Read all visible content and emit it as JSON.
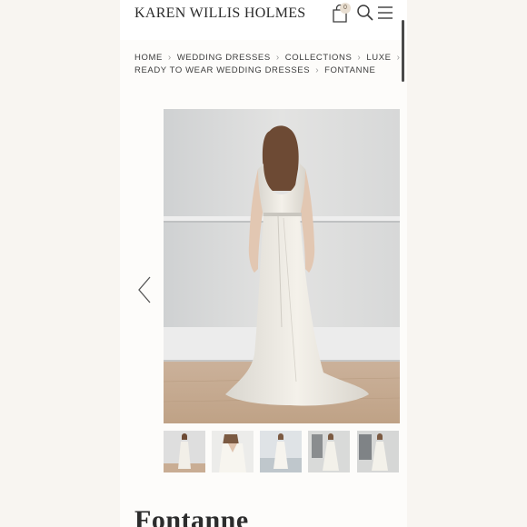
{
  "header": {
    "brand": "KAREN WILLIS HOLMES",
    "cart_count": "0"
  },
  "breadcrumb": {
    "items": [
      "HOME",
      "WEDDING DRESSES",
      "COLLECTIONS",
      "LUXE",
      "READY TO WEAR WEDDING DRESSES",
      "FONTANNE"
    ]
  },
  "product": {
    "title": "Fontanne"
  },
  "icons": {
    "cart": "shopping-bag-icon",
    "search": "search-icon",
    "menu": "hamburger-menu-icon",
    "prev": "chevron-left-icon"
  },
  "colors": {
    "background": "#f8f5f1",
    "page": "#fdfcfa",
    "text": "#2b2b2b"
  }
}
